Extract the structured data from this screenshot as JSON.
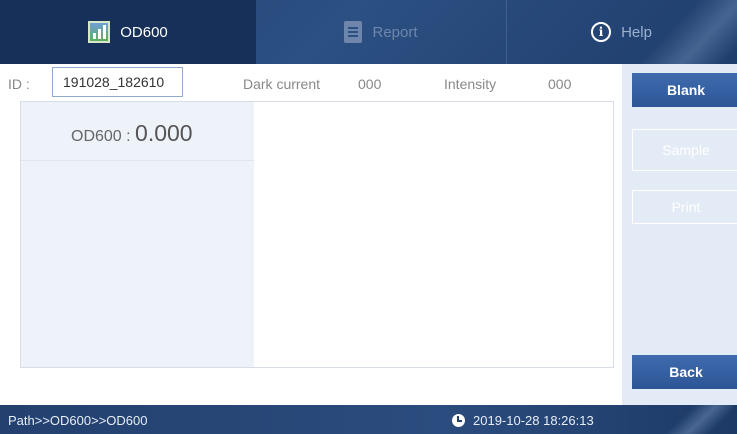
{
  "tabs": [
    {
      "label": "OD600",
      "icon": "od600-chart-icon",
      "active": true
    },
    {
      "label": "Report",
      "icon": "report-icon",
      "active": false
    },
    {
      "label": "Help",
      "icon": "info-icon",
      "active": false
    }
  ],
  "info": {
    "id_label": "ID :",
    "id_value": "191028_182610",
    "dark_current_label": "Dark current",
    "dark_current_value": "000",
    "intensity_label": "Intensity",
    "intensity_value": "000"
  },
  "reading": {
    "label": "OD600 :",
    "value": "0.000"
  },
  "buttons": {
    "blank": "Blank",
    "sample": "Sample",
    "print": "Print",
    "back": "Back"
  },
  "status": {
    "path": "Path>>OD600>>OD600",
    "datetime": "2019-10-28 18:26:13"
  },
  "colors": {
    "header_bg": "#2c5083",
    "active_tab_bg": "#16305a",
    "button_bg": "#3f6cae",
    "side_panel_bg": "#e3ebf6"
  }
}
